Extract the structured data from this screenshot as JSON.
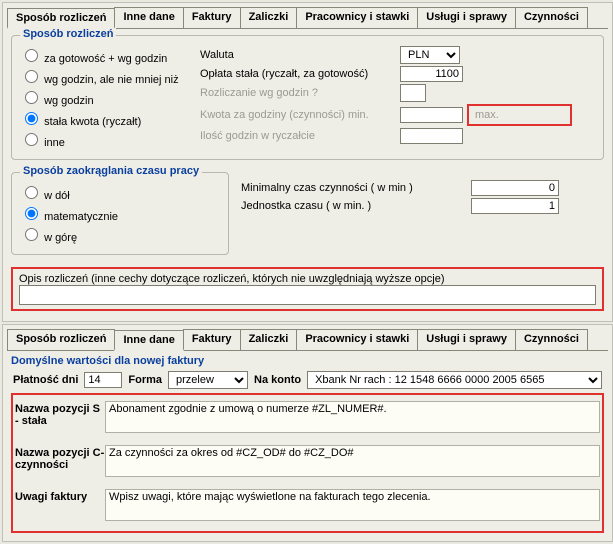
{
  "tabs_top": [
    "Sposób rozliczeń",
    "Inne dane",
    "Faktury",
    "Zaliczki",
    "Pracownicy i stawki",
    "Usługi i sprawy",
    "Czynności"
  ],
  "tabs_bottom": [
    "Sposób rozliczeń",
    "Inne dane",
    "Faktury",
    "Zaliczki",
    "Pracownicy i stawki",
    "Usługi i sprawy",
    "Czynności"
  ],
  "settlement": {
    "group_title": "Sposób rozliczeń",
    "options": {
      "o1": "za gotowość + wg godzin",
      "o2": "wg godzin, ale nie mniej niż",
      "o3": "wg godzin",
      "o4": "stała kwota (ryczałt)",
      "o5": "inne"
    },
    "currency_label": "Waluta",
    "currency_value": "PLN",
    "flat_fee_label": "Opłata stała (ryczałt, za gotowość)",
    "flat_fee_value": "1100",
    "hour_billing_label": "Rozliczanie wg godzin ?",
    "hour_rate_label": "Kwota za godziny (czynności)   min.",
    "max_label": "max.",
    "hours_in_flat_label": "Ilość godzin w ryczałcie"
  },
  "rounding": {
    "group_title": "Sposób zaokrąglania czasu pracy",
    "options": {
      "r1": "w dół",
      "r2": "matematycznie",
      "r3": "w górę"
    },
    "min_time_label": "Minimalny czas czynności  ( w min )",
    "min_time_value": "0",
    "unit_label": "Jednostka czasu ( w min. )",
    "unit_value": "1"
  },
  "description": {
    "label": "Opis rozliczeń (inne cechy dotyczące rozliczeń, których nie uwzględniają wyższe opcje)",
    "value": ""
  },
  "invoice_defaults": {
    "group_title": "Domyślne wartości dla nowej faktury",
    "payment_days_label": "Płatność dni",
    "payment_days_value": "14",
    "form_label": "Forma",
    "form_value": "przelew",
    "account_label": "Na konto",
    "account_value": "Xbank Nr rach : 12 1548 6666 0000 2005 6565",
    "row_s_label": "Nazwa pozycji S - stała",
    "row_s_value": "Abonament zgodnie z umową o numerze #ZL_NUMER#.",
    "row_c_label": "Nazwa pozycji C-czynności",
    "row_c_value": "Za czynności za okres od #CZ_OD# do #CZ_DO#",
    "notes_label": "Uwagi faktury",
    "notes_value": "Wpisz uwagi, które mając wyświetlone na fakturach tego zlecenia."
  }
}
